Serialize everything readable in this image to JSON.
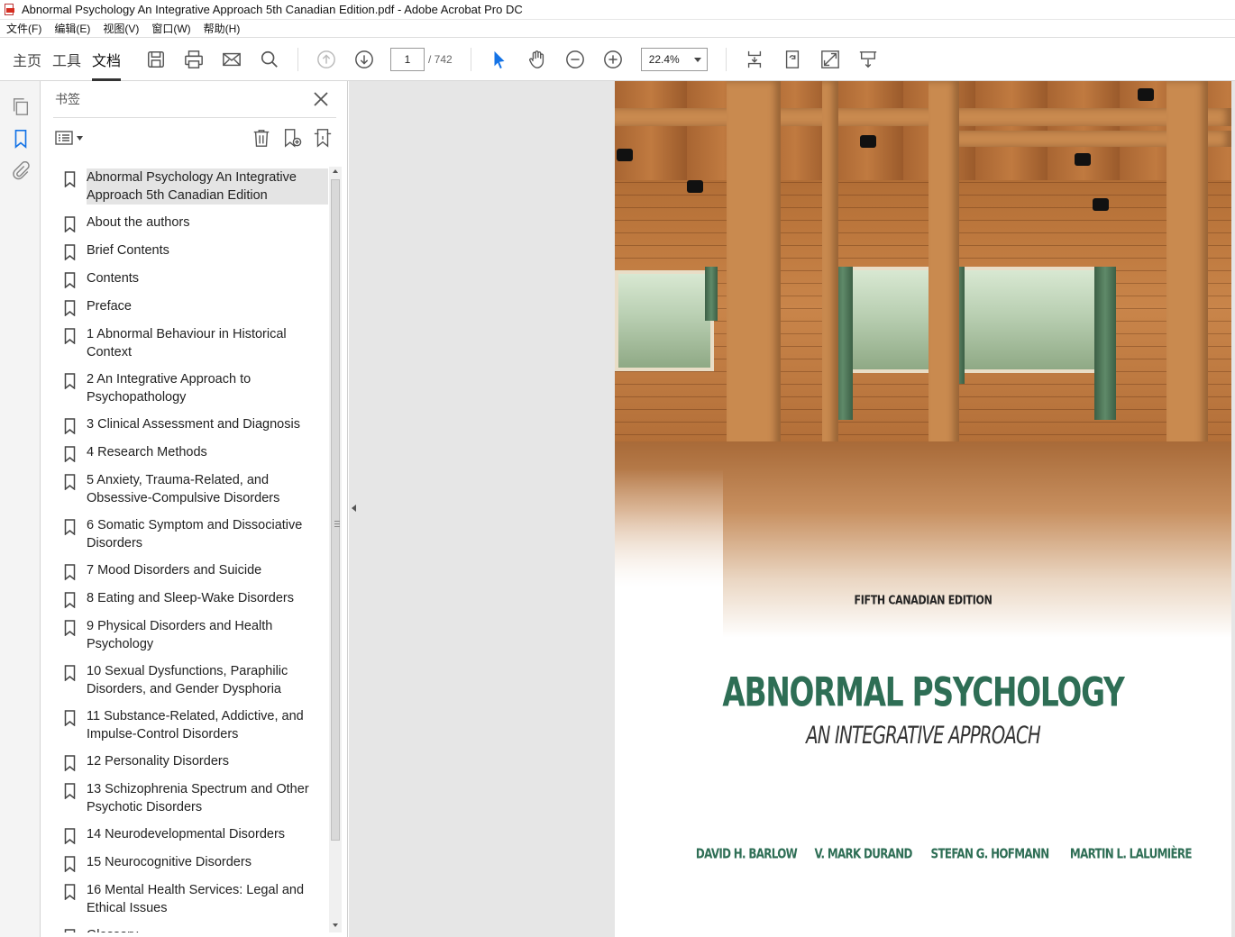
{
  "window": {
    "title": "Abnormal Psychology An Integrative Approach 5th Canadian Edition.pdf - Adobe Acrobat Pro DC"
  },
  "menubar": {
    "items": [
      "文件(F)",
      "编辑(E)",
      "视图(V)",
      "窗口(W)",
      "帮助(H)"
    ]
  },
  "toolbar": {
    "tabs": [
      "主页",
      "工具",
      "文档"
    ],
    "active_tab": "文档",
    "current_page": "1",
    "total_pages": "/ 742",
    "zoom": "22.4%"
  },
  "bookmarks_panel": {
    "title": "书签",
    "items": [
      "Abnormal Psychology An Integrative Approach 5th Canadian Edition",
      "About the authors",
      "Brief Contents",
      "Contents",
      "Preface",
      "1 Abnormal Behaviour in Historical Context",
      "2 An Integrative Approach to Psychopathology",
      "3 Clinical Assessment and Diagnosis",
      "4 Research Methods",
      "5 Anxiety, Trauma-Related, and Obsessive-Compulsive Disorders",
      "6 Somatic Symptom and Dissociative Disorders",
      "7 Mood Disorders and Suicide",
      "8 Eating and Sleep-Wake Disorders",
      "9 Physical Disorders and Health Psychology",
      "10 Sexual Dysfunctions, Paraphilic Disorders, and Gender Dysphoria",
      "11 Substance-Related, Addictive, and Impulse-Control Disorders",
      "12 Personality Disorders",
      "13 Schizophrenia Spectrum and Other Psychotic Disorders",
      "14 Neurodevelopmental Disorders",
      "15 Neurocognitive Disorders",
      "16 Mental Health Services: Legal and Ethical Issues",
      "Glossary"
    ],
    "selected_index": 0
  },
  "cover": {
    "edition": "FIFTH CANADIAN EDITION",
    "title": "ABNORMAL PSYCHOLOGY",
    "subtitle": "AN INTEGRATIVE APPROACH",
    "authors": [
      "DAVID H. BARLOW",
      "V. MARK DURAND",
      "STEFAN G. HOFMANN",
      "MARTIN L.  LALUMIÈRE"
    ]
  },
  "colors": {
    "cover_green": "#2e6e55",
    "accent_blue": "#1473e6"
  }
}
